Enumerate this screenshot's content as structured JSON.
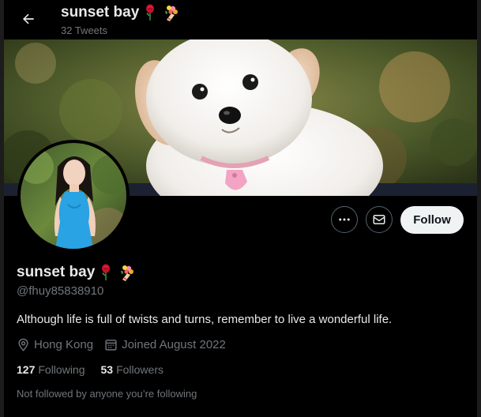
{
  "header": {
    "name": "sunset bay",
    "tweet_count": "32 Tweets"
  },
  "profile": {
    "display_name": "sunset bay",
    "handle": "@fhuy85838910",
    "bio": "Although life is full of twists and turns, remember to live a wonderful life.",
    "location": "Hong Kong",
    "joined": "Joined August 2022",
    "following_count": "127",
    "following_label": "Following",
    "followers_count": "53",
    "followers_label": "Followers",
    "followed_note": "Not followed by anyone you’re following"
  },
  "actions": {
    "follow_label": "Follow"
  },
  "icons": {
    "back": "arrow-left-icon",
    "more": "more-horizontal-icon",
    "message": "envelope-icon",
    "location": "location-pin-icon",
    "calendar": "calendar-icon",
    "rose": "rose-emoji-icon",
    "bouquet": "bouquet-emoji-icon"
  },
  "colors": {
    "background": "#000000",
    "primary_text": "#e7e9ea",
    "secondary_text": "#71767b",
    "follow_button_bg": "#eff3f4",
    "follow_button_text": "#0f1419",
    "border": "#536471"
  }
}
